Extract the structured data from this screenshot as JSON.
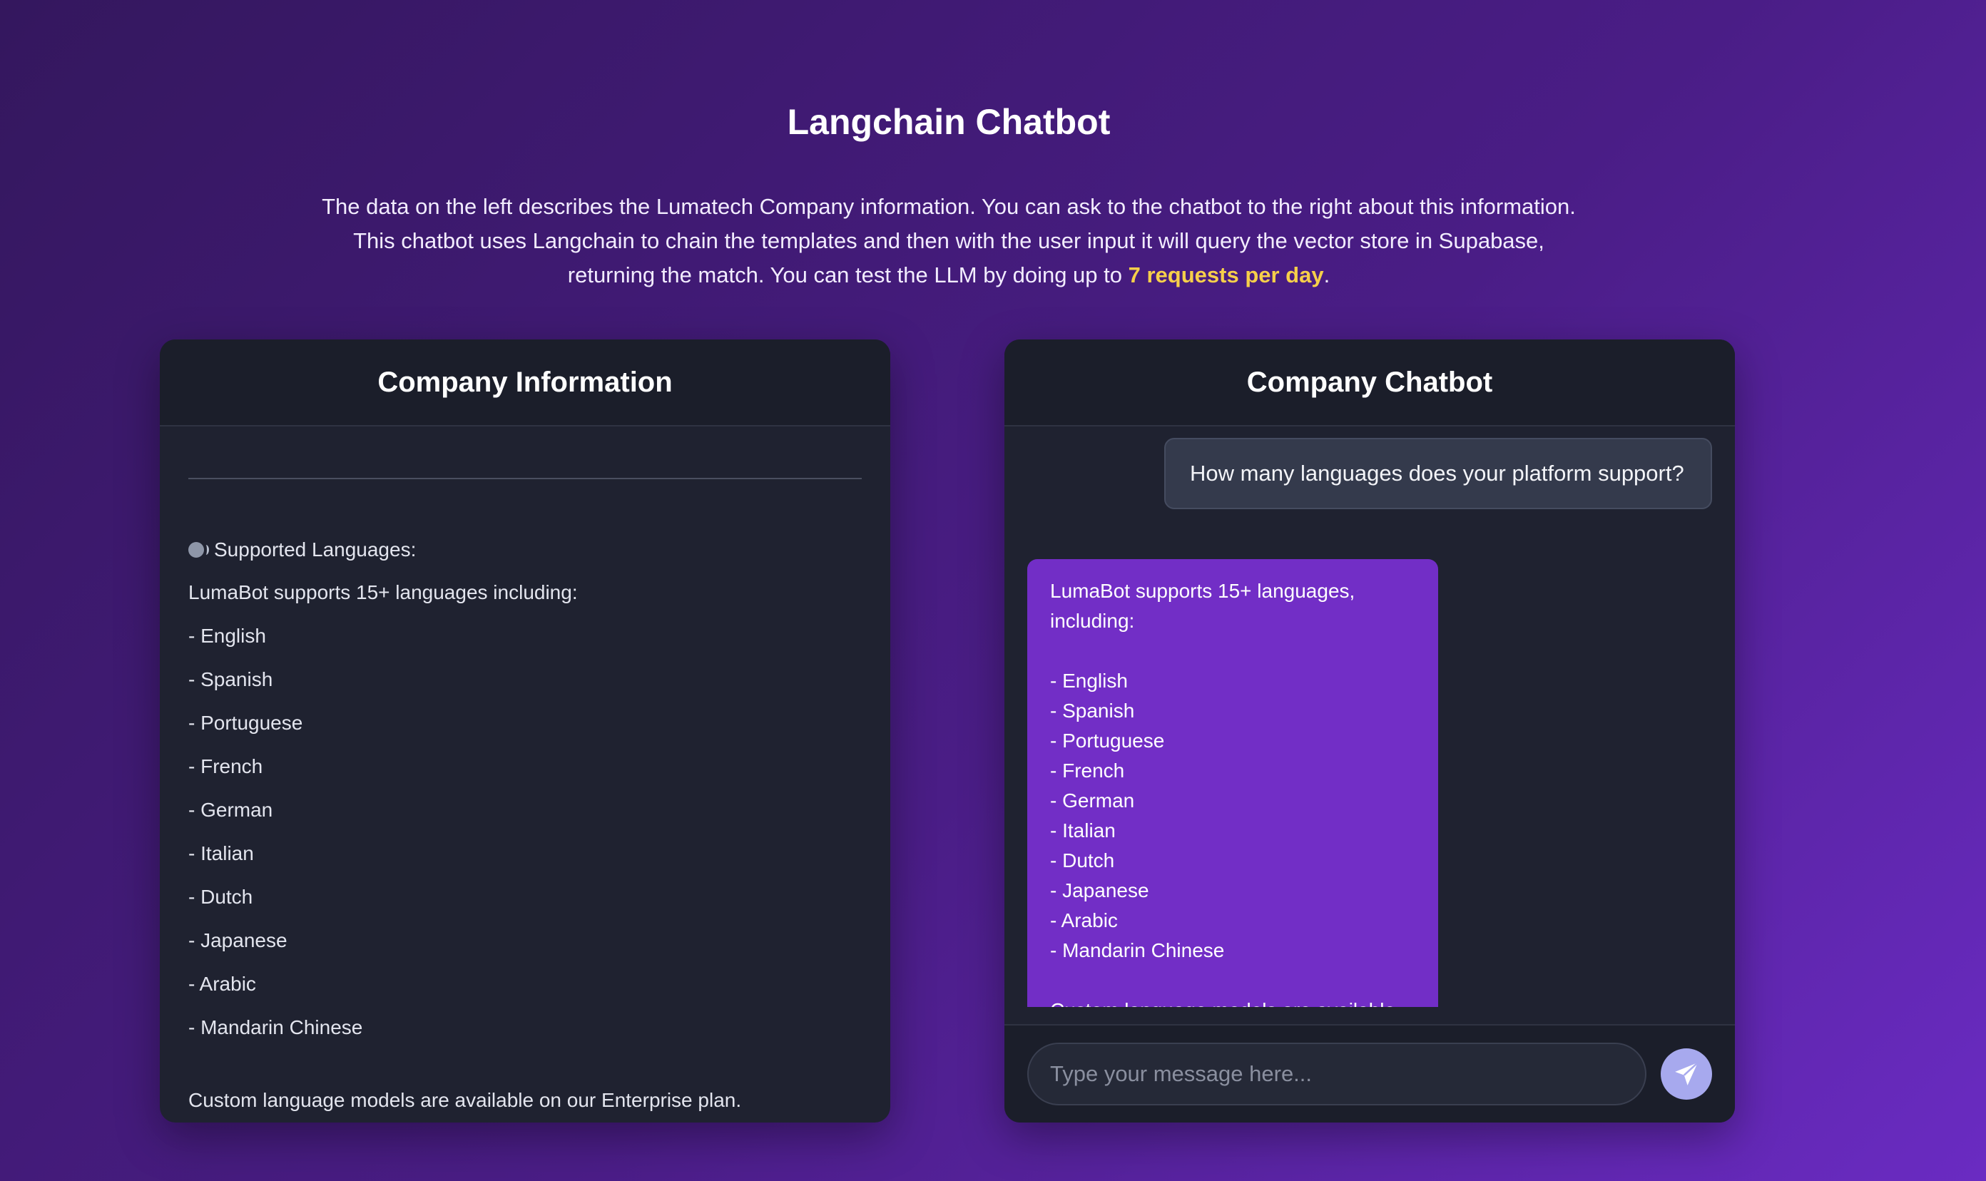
{
  "page": {
    "title": "Langchain Chatbot",
    "intro_before": "The data on the left describes the Lumatech Company information. You can ask to the chatbot to the right about this information. This chatbot uses Langchain to chain the templates and then with the user input it will query the vector store in Supabase, returning the match. You can test the LLM by doing up to ",
    "intro_highlight": "7 requests per day",
    "intro_after": "."
  },
  "company_info": {
    "title": "Company Information",
    "section_icon": "speaking-head-icon",
    "section_heading": "Supported Languages:",
    "intro_line": "LumaBot supports 15+ languages including:",
    "languages": [
      "- English",
      "- Spanish",
      "- Portuguese",
      "- French",
      "- German",
      "- Italian",
      "- Dutch",
      "- Japanese",
      "- Arabic",
      "- Mandarin Chinese"
    ],
    "footer": "Custom language models are available on our Enterprise plan."
  },
  "chatbot": {
    "title": "Company Chatbot",
    "messages": {
      "user": "How many languages does your platform support?",
      "bot_intro": "LumaBot supports 15+ languages, including:",
      "bot_languages": [
        "- English",
        "- Spanish",
        "- Portuguese",
        "- French",
        "- German",
        "- Italian",
        "- Dutch",
        "- Japanese",
        "- Arabic",
        "- Mandarin Chinese"
      ],
      "bot_footer": "Custom language models are available"
    },
    "input": {
      "value": "",
      "placeholder": "Type your message here..."
    },
    "send_icon": "paper-plane-icon"
  },
  "colors": {
    "background_start": "#34175e",
    "background_end": "#6a2bc2",
    "panel": "#1f2230",
    "bot_bubble": "#722ec6",
    "user_bubble": "#343a4c",
    "highlight": "#f6cf4a",
    "send_button": "#a7a9ee"
  }
}
